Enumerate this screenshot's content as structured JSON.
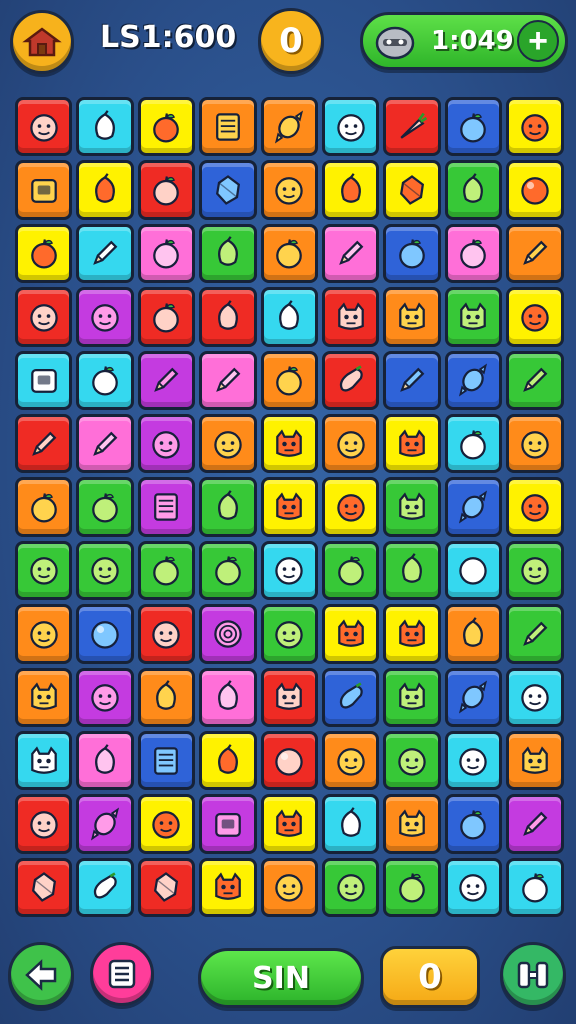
{
  "header": {
    "level_label": "LS1:600",
    "shield_label": "0",
    "timer": "1:049",
    "plus_label": "+"
  },
  "footer": {
    "action_label": "SIN",
    "counter_label": "0"
  },
  "colors": {
    "R": "#ef2b24",
    "C": "#35d8ef",
    "Y": "#fff200",
    "O": "#ff8b1a",
    "G": "#37c837",
    "P": "#ff6fd8",
    "M": "#c43be0",
    "B": "#2f63d8",
    "L": "#8fe02a"
  },
  "board": {
    "rows": [
      [
        "R:face",
        "C:fruit",
        "Y:apple",
        "O:book",
        "O:candy",
        "C:face",
        "R:carrot",
        "B:apple",
        "Y:face"
      ],
      [
        "O:box",
        "Y:fruit",
        "R:apple",
        "B:gem",
        "O:face",
        "Y:fruit",
        "Y:gem",
        "G:fruit",
        "Y:ball"
      ],
      [
        "Y:apple",
        "C:pencil",
        "P:apple",
        "G:fruit",
        "O:apple",
        "P:pencil",
        "B:apple",
        "P:apple",
        "O:pencil"
      ],
      [
        "R:face",
        "M:face",
        "R:apple",
        "R:fruit",
        "C:fruit",
        "R:monster",
        "O:monster",
        "G:monster",
        "Y:face"
      ],
      [
        "C:box",
        "C:apple",
        "M:pencil",
        "P:pencil",
        "O:apple",
        "R:eggplant",
        "B:pencil",
        "B:candy",
        "G:pencil"
      ],
      [
        "R:pencil",
        "P:pencil",
        "M:face",
        "O:face",
        "Y:monster",
        "O:face",
        "Y:monster",
        "C:apple",
        "O:face"
      ],
      [
        "O:apple",
        "G:apple",
        "M:book",
        "G:fruit",
        "Y:monster",
        "Y:face",
        "G:monster",
        "B:candy",
        "Y:face"
      ],
      [
        "G:face",
        "G:face",
        "G:apple",
        "G:apple",
        "C:face",
        "G:apple",
        "G:fruit",
        "C:ball",
        "G:face"
      ],
      [
        "O:face",
        "B:ball",
        "R:face",
        "M:swirl",
        "G:face",
        "Y:monster",
        "Y:monster",
        "O:fruit",
        "G:pencil"
      ],
      [
        "O:monster",
        "M:face",
        "O:fruit",
        "P:fruit",
        "R:monster",
        "B:eggplant",
        "G:monster",
        "B:candy",
        "C:face"
      ],
      [
        "C:monster",
        "P:fruit",
        "B:book",
        "Y:fruit",
        "R:ball",
        "O:face",
        "G:face",
        "C:face",
        "O:monster"
      ],
      [
        "R:face",
        "M:candy",
        "Y:face",
        "M:box",
        "Y:monster",
        "C:fruit",
        "O:monster",
        "B:apple",
        "M:pencil"
      ],
      [
        "R:gem",
        "C:eggplant",
        "R:gem",
        "Y:monster",
        "O:face",
        "G:face",
        "G:apple",
        "C:face",
        "C:apple"
      ]
    ]
  }
}
